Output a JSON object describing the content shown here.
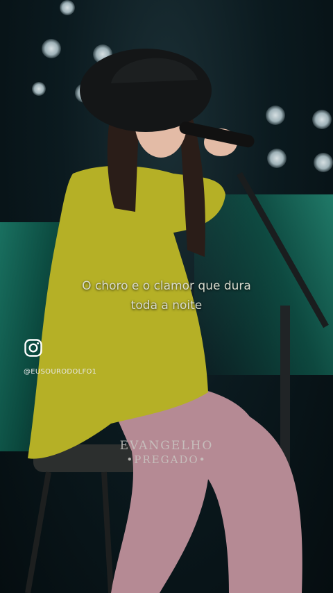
{
  "caption": {
    "line1": "O choro e o clamor que dura",
    "line2": "toda a noite"
  },
  "social": {
    "icon": "instagram-icon",
    "handle": "@EUSOURODOLFO1"
  },
  "watermark": {
    "line1": "EVANGELHO",
    "line2": "•PREGADO•"
  },
  "colors": {
    "shirt": "#b5b026",
    "pants": "#b58a94",
    "stage_green": "#1f8f78",
    "background": "#071318"
  }
}
